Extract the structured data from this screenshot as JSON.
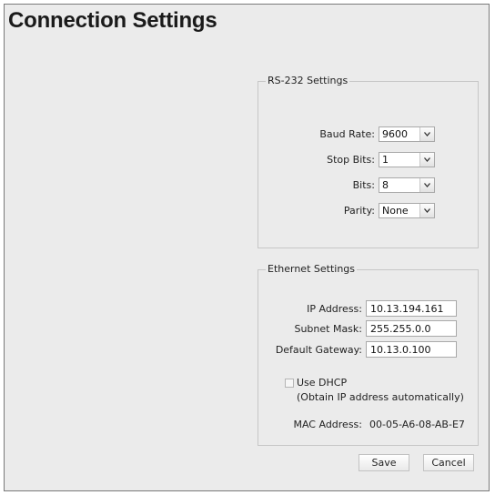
{
  "page": {
    "title": "Connection Settings"
  },
  "rs232": {
    "legend": "RS-232 Settings",
    "baud_rate": {
      "label": "Baud Rate:",
      "value": "9600"
    },
    "stop_bits": {
      "label": "Stop Bits:",
      "value": "1"
    },
    "bits": {
      "label": "Bits:",
      "value": "8"
    },
    "parity": {
      "label": "Parity:",
      "value": "None"
    }
  },
  "ethernet": {
    "legend": "Ethernet Settings",
    "ip_address": {
      "label": "IP Address:",
      "value": "10.13.194.161"
    },
    "subnet_mask": {
      "label": "Subnet Mask:",
      "value": "255.255.0.0"
    },
    "default_gateway": {
      "label": "Default Gateway:",
      "value": "10.13.0.100"
    },
    "use_dhcp": {
      "label": "Use DHCP",
      "hint": "(Obtain IP address automatically)",
      "checked": false
    },
    "mac_address": {
      "label": "MAC Address:",
      "value": "00-05-A6-08-AB-E7"
    }
  },
  "actions": {
    "save_label": "Save",
    "cancel_label": "Cancel"
  },
  "icons": {
    "dropdown": "chevron-down-icon"
  },
  "colors": {
    "panel_background": "#ebebeb",
    "frame_border": "#7a7a7a",
    "group_border": "#c6c6c6"
  }
}
